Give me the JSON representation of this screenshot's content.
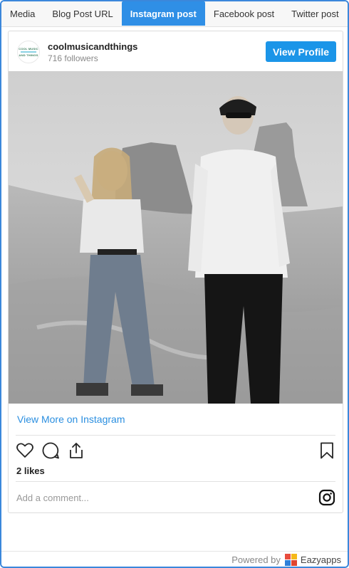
{
  "tabs": [
    {
      "label": "Media",
      "active": false
    },
    {
      "label": "Blog Post URL",
      "active": false
    },
    {
      "label": "Instagram post",
      "active": true
    },
    {
      "label": "Facebook post",
      "active": false
    },
    {
      "label": "Twitter post",
      "active": false
    }
  ],
  "post": {
    "username": "coolmusicandthings",
    "followers": "716 followers",
    "view_profile_label": "View Profile",
    "avatar_text": [
      "COOL MUSIC",
      "AND THINGS"
    ],
    "view_more_label": "View More on Instagram",
    "likes": "2 likes",
    "comment_placeholder": "Add a comment...",
    "icons": [
      "heart-icon",
      "comment-icon",
      "share-icon",
      "bookmark-icon",
      "instagram-icon"
    ]
  },
  "footer": {
    "powered_label": "Powered by",
    "brand": "Eazyapps"
  },
  "colors": {
    "accent": "#2f8fe6",
    "button": "#1b95e8",
    "link": "#2b8fe0",
    "frame_border": "#3b87db",
    "logo": [
      "#e84c3d",
      "#f5b819",
      "#2e7fd9",
      "#e0452f"
    ]
  }
}
